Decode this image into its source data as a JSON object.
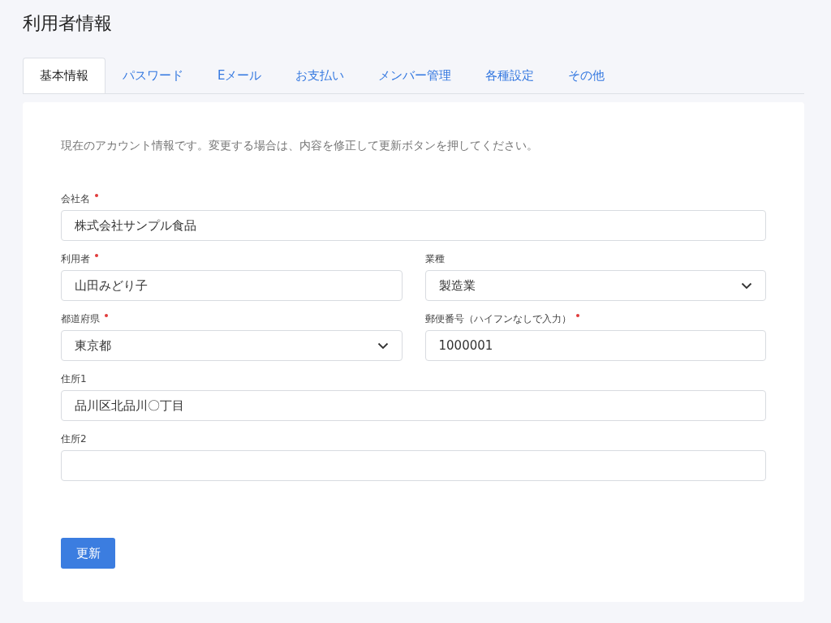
{
  "page_title": "利用者情報",
  "tabs": [
    {
      "label": "基本情報",
      "selected": true
    },
    {
      "label": "パスワード",
      "selected": false
    },
    {
      "label": "Eメール",
      "selected": false
    },
    {
      "label": "お支払い",
      "selected": false
    },
    {
      "label": "メンバー管理",
      "selected": false
    },
    {
      "label": "各種設定",
      "selected": false
    },
    {
      "label": "その他",
      "selected": false
    }
  ],
  "description": "現在のアカウント情報です。変更する場合は、内容を修正して更新ボタンを押してください。",
  "form_rows": [
    {
      "fields": [
        {
          "label": "会社名",
          "required": true,
          "kind": "text",
          "value": "株式会社サンプル食品"
        }
      ]
    },
    {
      "fields": [
        {
          "label": "利用者",
          "required": true,
          "kind": "text",
          "value": "山田みどり子"
        },
        {
          "label": "業種",
          "required": false,
          "kind": "select",
          "value": "製造業"
        }
      ]
    },
    {
      "fields": [
        {
          "label": "都道府県",
          "required": true,
          "kind": "select",
          "value": "東京都"
        },
        {
          "label": "郵便番号（ハイフンなしで入力）",
          "required": true,
          "kind": "text",
          "value": "1000001"
        }
      ]
    },
    {
      "fields": [
        {
          "label": "住所1",
          "required": false,
          "kind": "text",
          "value": "品川区北品川〇丁目"
        }
      ]
    },
    {
      "fields": [
        {
          "label": "住所2",
          "required": false,
          "kind": "text"
        }
      ]
    }
  ],
  "submit_button": "更新"
}
